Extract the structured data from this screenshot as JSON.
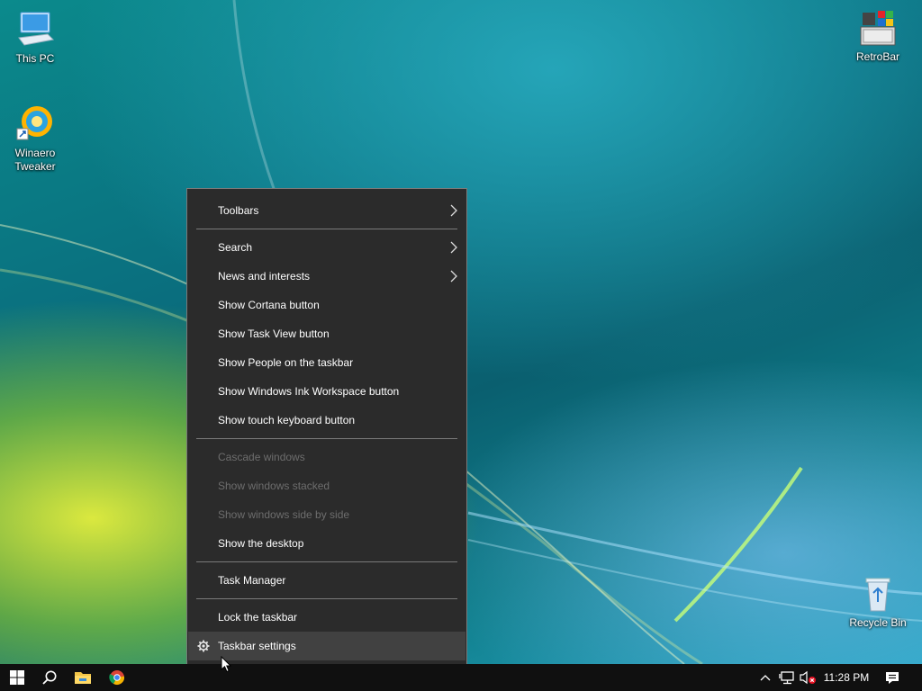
{
  "desktop": {
    "icons": [
      {
        "label": "This PC",
        "icon": "this-pc-icon"
      },
      {
        "label": "Winaero\nTweaker",
        "icon": "winaero-tweaker-icon"
      },
      {
        "label": "RetroBar",
        "icon": "retrobar-icon"
      },
      {
        "label": "Recycle Bin",
        "icon": "recycle-bin-icon"
      }
    ]
  },
  "context_menu": {
    "items": [
      {
        "label": "Toolbars",
        "submenu": true,
        "enabled": true
      },
      {
        "label": "Search",
        "submenu": true,
        "enabled": true
      },
      {
        "label": "News and interests",
        "submenu": true,
        "enabled": true
      },
      {
        "label": "Show Cortana button",
        "enabled": true
      },
      {
        "label": "Show Task View button",
        "enabled": true
      },
      {
        "label": "Show People on the taskbar",
        "enabled": true
      },
      {
        "label": "Show Windows Ink Workspace button",
        "enabled": true
      },
      {
        "label": "Show touch keyboard button",
        "enabled": true
      },
      {
        "label": "Cascade windows",
        "enabled": false
      },
      {
        "label": "Show windows stacked",
        "enabled": false
      },
      {
        "label": "Show windows side by side",
        "enabled": false
      },
      {
        "label": "Show the desktop",
        "enabled": true
      },
      {
        "label": "Task Manager",
        "enabled": true
      },
      {
        "label": "Lock the taskbar",
        "enabled": true
      },
      {
        "label": "Taskbar settings",
        "enabled": true,
        "hovered": true,
        "icon": "gear-icon"
      }
    ]
  },
  "taskbar": {
    "buttons": [
      "start-button",
      "search-icon",
      "file-explorer-icon",
      "chrome-icon"
    ],
    "tray": [
      "show-hidden-icons-chevron",
      "network-icon",
      "volume-muted-icon"
    ],
    "clock": "11:28 PM",
    "notification_icon": "action-center-icon"
  },
  "colors": {
    "menu_bg": "#2b2b2b",
    "menu_hover": "#414141",
    "menu_border": "#7a7a7a",
    "disabled_text": "#6d6d6d",
    "taskbar_bg": "#101010"
  }
}
